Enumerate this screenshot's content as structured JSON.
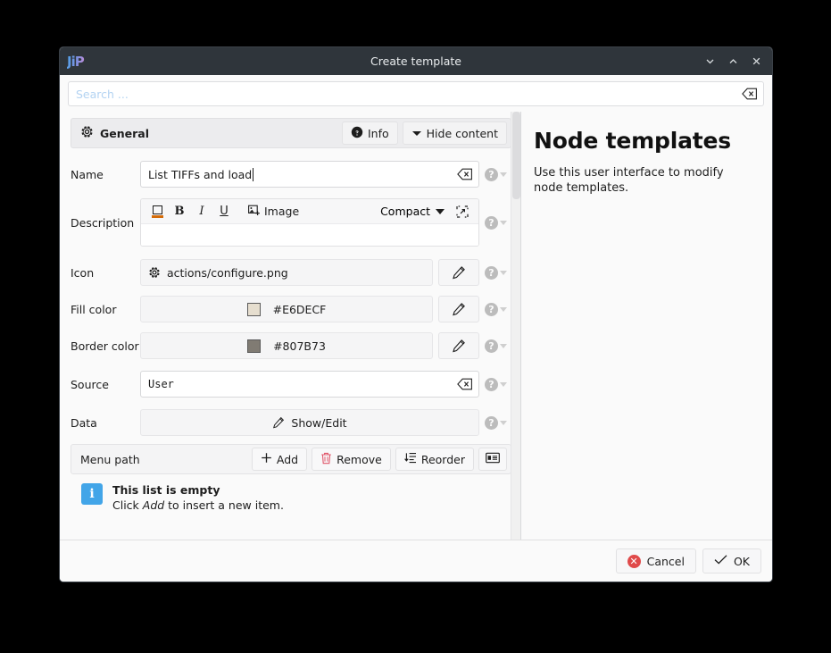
{
  "window": {
    "logo_text": "JiP",
    "title": "Create template",
    "controls": {
      "minimize": "minimize-chevron-down",
      "maximize": "maximize-chevron-up",
      "close": "close-x"
    }
  },
  "search": {
    "placeholder": "Search ...",
    "value": "",
    "clear_label": "clear-search"
  },
  "group": {
    "title": "General",
    "icon": "gear-icon",
    "info_label": "Info",
    "hide_label": "Hide content"
  },
  "form": {
    "rows": [
      {
        "label": "Name",
        "value": "List TIFFs and load"
      },
      {
        "label": "Description",
        "value": ""
      },
      {
        "label": "Icon",
        "value": "actions/configure.png"
      },
      {
        "label": "Fill color",
        "value": "#E6DECF",
        "swatch": "#E6DECF"
      },
      {
        "label": "Border color",
        "value": "#807B73",
        "swatch": "#807B73"
      },
      {
        "label": "Source",
        "value": "User"
      },
      {
        "label": "Data",
        "value": "Show/Edit"
      }
    ],
    "help_glyph": "?"
  },
  "description_editor": {
    "buttons": [
      "text-color",
      "B",
      "I",
      "U"
    ],
    "image_label": "Image",
    "mode_label": "Compact",
    "expand_label": "expand-editor",
    "content": ""
  },
  "menu_path": {
    "label": "Menu path",
    "buttons": [
      {
        "label": "Add",
        "icon": "plus-icon"
      },
      {
        "label": "Remove",
        "icon": "trash-icon"
      },
      {
        "label": "Reorder",
        "icon": "reorder-icon"
      }
    ],
    "view_button": "list-view-icon"
  },
  "empty_list": {
    "badge": "i",
    "title": "This list is empty",
    "hint_prefix": "Click ",
    "hint_emphasis": "Add",
    "hint_suffix": " to insert a new item."
  },
  "doc_panel": {
    "title": "Node templates",
    "body": "Use this user interface to modify node templates."
  },
  "footer": {
    "cancel_label": "Cancel",
    "ok_label": "OK"
  },
  "colors": {
    "titlebar": "#2F353B",
    "fill_swatch": "#E6DECF",
    "border_swatch": "#807B73",
    "info_badge": "#42A5E8",
    "cancel_icon": "#E04A4A",
    "placeholder": "#B3D3F2",
    "accent_underline": "#D46B08"
  }
}
